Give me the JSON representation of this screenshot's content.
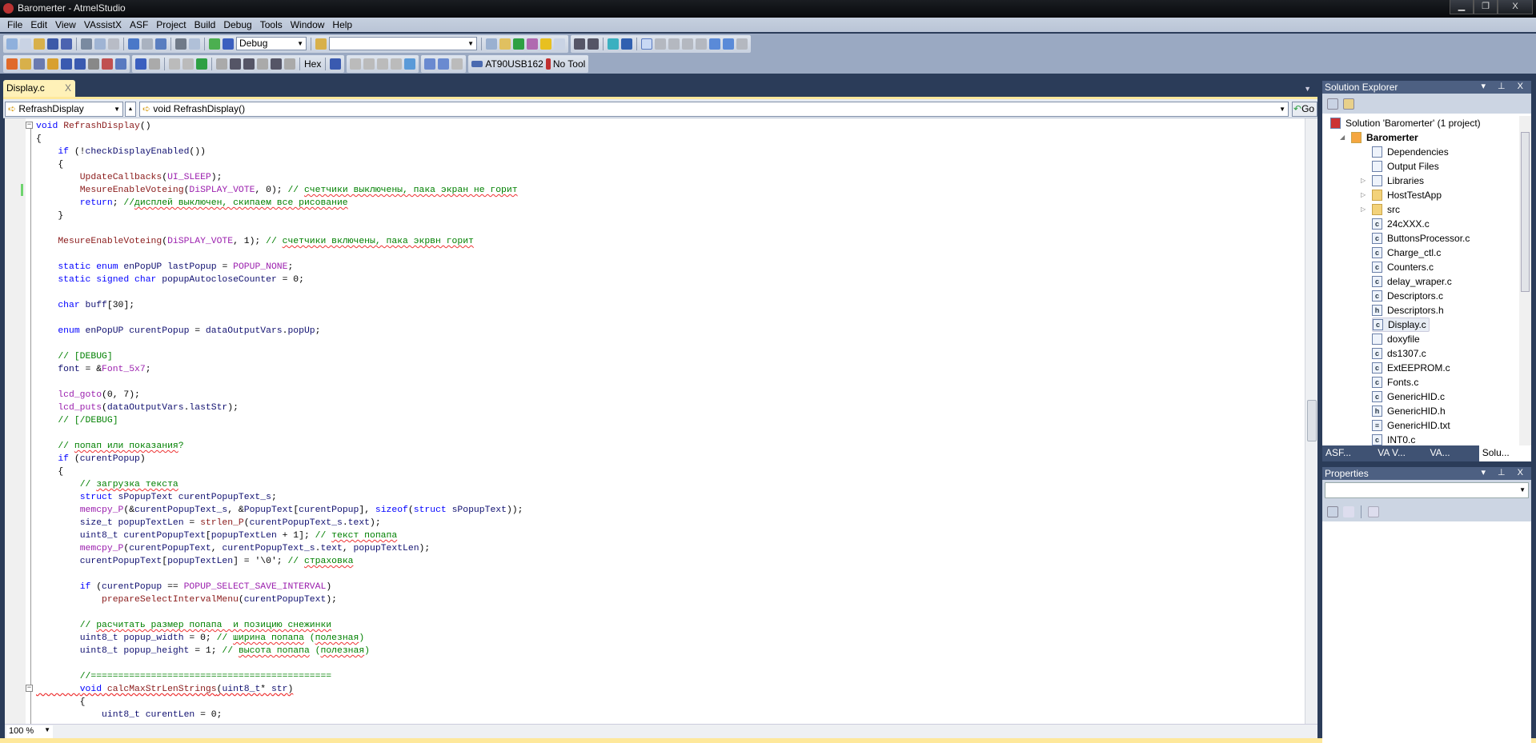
{
  "window": {
    "title": "Baromerter - AtmelStudio",
    "minimize": "▁",
    "restore": "❐",
    "close": "X"
  },
  "menu": [
    "File",
    "Edit",
    "View",
    "VAssistX",
    "ASF",
    "Project",
    "Build",
    "Debug",
    "Tools",
    "Window",
    "Help"
  ],
  "toolbar": {
    "config": "Debug",
    "search_value": "",
    "hex": "Hex",
    "device": "AT90USB162",
    "tool": "No Tool"
  },
  "tabs": [
    {
      "label": "Display.c",
      "close": "X"
    }
  ],
  "nav": {
    "scope": "RefrashDisplay",
    "member": "void RefrashDisplay()",
    "go": "Go"
  },
  "status": {
    "zoom": "100 %"
  },
  "code": [
    [
      [
        "k",
        "void"
      ],
      [
        "t",
        " "
      ],
      [
        "f",
        "RefrashDisplay"
      ],
      [
        "t",
        "()"
      ]
    ],
    [
      [
        "t",
        "{"
      ]
    ],
    [
      [
        "t",
        "    "
      ],
      [
        "k",
        "if"
      ],
      [
        "t",
        " (!"
      ],
      [
        "v",
        "checkDisplayEnabled"
      ],
      [
        "t",
        "())"
      ]
    ],
    [
      [
        "t",
        "    {"
      ]
    ],
    [
      [
        "t",
        "        "
      ],
      [
        "f",
        "UpdateCallbacks"
      ],
      [
        "t",
        "("
      ],
      [
        "m",
        "UI_SLEEP"
      ],
      [
        "t",
        ");"
      ]
    ],
    [
      [
        "t",
        "        "
      ],
      [
        "f",
        "MesureEnableVoteing"
      ],
      [
        "t",
        "("
      ],
      [
        "m",
        "DiSPLAY_VOTE"
      ],
      [
        "t",
        ", 0); "
      ],
      [
        "c",
        "// "
      ],
      [
        "s",
        "счетчики выключены, пака экран не горит"
      ]
    ],
    [
      [
        "t",
        "        "
      ],
      [
        "k",
        "return"
      ],
      [
        "t",
        "; "
      ],
      [
        "c",
        "//"
      ],
      [
        "s",
        "дисплей выключен, скипаем все рисование"
      ]
    ],
    [
      [
        "t",
        "    }"
      ]
    ],
    [],
    [
      [
        "t",
        "    "
      ],
      [
        "f",
        "MesureEnableVoteing"
      ],
      [
        "t",
        "("
      ],
      [
        "m",
        "DiSPLAY_VOTE"
      ],
      [
        "t",
        ", 1); "
      ],
      [
        "c",
        "// "
      ],
      [
        "s",
        "счетчики включены, пака экрвн горит"
      ]
    ],
    [],
    [
      [
        "t",
        "    "
      ],
      [
        "k",
        "static enum"
      ],
      [
        "t",
        " "
      ],
      [
        "v",
        "enPopUP lastPopup"
      ],
      [
        "t",
        " = "
      ],
      [
        "m",
        "POPUP_NONE"
      ],
      [
        "t",
        ";"
      ]
    ],
    [
      [
        "t",
        "    "
      ],
      [
        "k",
        "static signed char"
      ],
      [
        "t",
        " "
      ],
      [
        "v",
        "popupAutocloseCounter"
      ],
      [
        "t",
        " = 0;"
      ]
    ],
    [],
    [
      [
        "t",
        "    "
      ],
      [
        "k",
        "char"
      ],
      [
        "t",
        " "
      ],
      [
        "v",
        "buff"
      ],
      [
        "t",
        "[30];"
      ]
    ],
    [],
    [
      [
        "t",
        "    "
      ],
      [
        "k",
        "enum"
      ],
      [
        "t",
        " "
      ],
      [
        "v",
        "enPopUP curentPopup"
      ],
      [
        "t",
        " = "
      ],
      [
        "v",
        "dataOutputVars"
      ],
      [
        "t",
        "."
      ],
      [
        "v",
        "popUp"
      ],
      [
        "t",
        ";"
      ]
    ],
    [],
    [
      [
        "t",
        "    "
      ],
      [
        "c",
        "// [DEBUG]"
      ]
    ],
    [
      [
        "t",
        "    "
      ],
      [
        "v",
        "font"
      ],
      [
        "t",
        " = &"
      ],
      [
        "m",
        "Font_5x7"
      ],
      [
        "t",
        ";"
      ]
    ],
    [],
    [
      [
        "t",
        "    "
      ],
      [
        "m",
        "lcd_goto"
      ],
      [
        "t",
        "(0, 7);"
      ]
    ],
    [
      [
        "t",
        "    "
      ],
      [
        "m",
        "lcd_puts"
      ],
      [
        "t",
        "("
      ],
      [
        "v",
        "dataOutputVars"
      ],
      [
        "t",
        "."
      ],
      [
        "v",
        "lastStr"
      ],
      [
        "t",
        ");"
      ]
    ],
    [
      [
        "t",
        "    "
      ],
      [
        "c",
        "// [/DEBUG]"
      ]
    ],
    [],
    [
      [
        "t",
        "    "
      ],
      [
        "c",
        "// "
      ],
      [
        "s",
        "попап или показания"
      ],
      [
        "c",
        "?"
      ]
    ],
    [
      [
        "t",
        "    "
      ],
      [
        "k",
        "if"
      ],
      [
        "t",
        " ("
      ],
      [
        "v",
        "curentPopup"
      ],
      [
        "t",
        ")"
      ]
    ],
    [
      [
        "t",
        "    {"
      ]
    ],
    [
      [
        "t",
        "        "
      ],
      [
        "c",
        "// "
      ],
      [
        "s",
        "загрузка текста"
      ]
    ],
    [
      [
        "t",
        "        "
      ],
      [
        "k",
        "struct"
      ],
      [
        "t",
        " "
      ],
      [
        "v",
        "sPopupText curentPopupText_s"
      ],
      [
        "t",
        ";"
      ]
    ],
    [
      [
        "t",
        "        "
      ],
      [
        "m",
        "memcpy_P"
      ],
      [
        "t",
        "(&"
      ],
      [
        "v",
        "curentPopupText_s"
      ],
      [
        "t",
        ", &"
      ],
      [
        "v",
        "PopupText"
      ],
      [
        "t",
        "["
      ],
      [
        "v",
        "curentPopup"
      ],
      [
        "t",
        "], "
      ],
      [
        "k",
        "sizeof"
      ],
      [
        "t",
        "("
      ],
      [
        "k",
        "struct"
      ],
      [
        "t",
        " "
      ],
      [
        "v",
        "sPopupText"
      ],
      [
        "t",
        "));"
      ]
    ],
    [
      [
        "t",
        "        "
      ],
      [
        "v",
        "size_t popupTextLen"
      ],
      [
        "t",
        " = "
      ],
      [
        "f",
        "strlen_P"
      ],
      [
        "t",
        "("
      ],
      [
        "v",
        "curentPopupText_s"
      ],
      [
        "t",
        "."
      ],
      [
        "v",
        "text"
      ],
      [
        "t",
        ");"
      ]
    ],
    [
      [
        "t",
        "        "
      ],
      [
        "v",
        "uint8_t curentPopupText"
      ],
      [
        "t",
        "["
      ],
      [
        "v",
        "popupTextLen"
      ],
      [
        "t",
        " + 1]; "
      ],
      [
        "c",
        "// "
      ],
      [
        "s",
        "текст попапа"
      ]
    ],
    [
      [
        "t",
        "        "
      ],
      [
        "m",
        "memcpy_P"
      ],
      [
        "t",
        "("
      ],
      [
        "v",
        "curentPopupText"
      ],
      [
        "t",
        ", "
      ],
      [
        "v",
        "curentPopupText_s"
      ],
      [
        "t",
        "."
      ],
      [
        "v",
        "text"
      ],
      [
        "t",
        ", "
      ],
      [
        "v",
        "popupTextLen"
      ],
      [
        "t",
        ");"
      ]
    ],
    [
      [
        "t",
        "        "
      ],
      [
        "v",
        "curentPopupText"
      ],
      [
        "t",
        "["
      ],
      [
        "v",
        "popupTextLen"
      ],
      [
        "t",
        "] = '\\0'; "
      ],
      [
        "c",
        "// "
      ],
      [
        "s",
        "страховка"
      ]
    ],
    [],
    [
      [
        "t",
        "        "
      ],
      [
        "k",
        "if"
      ],
      [
        "t",
        " ("
      ],
      [
        "v",
        "curentPopup"
      ],
      [
        "t",
        " == "
      ],
      [
        "m",
        "POPUP_SELECT_SAVE_INTERVAL"
      ],
      [
        "t",
        ")"
      ]
    ],
    [
      [
        "t",
        "            "
      ],
      [
        "f",
        "prepareSelectIntervalMenu"
      ],
      [
        "t",
        "("
      ],
      [
        "v",
        "curentPopupText"
      ],
      [
        "t",
        ");"
      ]
    ],
    [],
    [
      [
        "t",
        "        "
      ],
      [
        "c",
        "// "
      ],
      [
        "s",
        "расчитать размер попапа  и позицию снежинки"
      ]
    ],
    [
      [
        "t",
        "        "
      ],
      [
        "v",
        "uint8_t popup_width"
      ],
      [
        "t",
        " = 0; "
      ],
      [
        "c",
        "// "
      ],
      [
        "s",
        "ширина попапа"
      ],
      [
        "c",
        " ("
      ],
      [
        "s",
        "полезная"
      ],
      [
        "c",
        ")"
      ]
    ],
    [
      [
        "t",
        "        "
      ],
      [
        "v",
        "uint8_t popup_height"
      ],
      [
        "t",
        " = 1; "
      ],
      [
        "c",
        "// "
      ],
      [
        "s",
        "высота попапа"
      ],
      [
        "c",
        " ("
      ],
      [
        "s",
        "полезная"
      ],
      [
        "c",
        ")"
      ]
    ],
    [],
    [
      [
        "t",
        "        "
      ],
      [
        "c",
        "//============================================"
      ]
    ],
    [
      [
        "t",
        "        "
      ],
      [
        "k",
        "void"
      ],
      [
        "t",
        " "
      ],
      [
        "f",
        "calcMaxStrLenStrings"
      ],
      [
        "t",
        "("
      ],
      [
        "v",
        "uint8_t"
      ],
      [
        "t",
        "* "
      ],
      [
        "v",
        "str"
      ],
      [
        "t",
        ")"
      ]
    ],
    [
      [
        "t",
        "        {"
      ]
    ],
    [
      [
        "t",
        "            "
      ],
      [
        "v",
        "uint8_t curentLen"
      ],
      [
        "t",
        " = 0;"
      ]
    ]
  ],
  "solution_explorer": {
    "title": "Solution Explorer",
    "controls": "▾ ⊥ X",
    "tree": [
      {
        "label": "Solution 'Baromerter' (1 project)",
        "icon": "sln",
        "level": 0
      },
      {
        "label": "Baromerter",
        "icon": "proj",
        "level": 1,
        "bold": true,
        "expander": "◢"
      },
      {
        "label": "Dependencies",
        "icon": "ref",
        "level": 2
      },
      {
        "label": "Output Files",
        "icon": "ref",
        "level": 2
      },
      {
        "label": "Libraries",
        "icon": "lib",
        "level": 2,
        "expander": "▷"
      },
      {
        "label": "HostTestApp",
        "icon": "folder",
        "level": 2,
        "expander": "▷"
      },
      {
        "label": "src",
        "icon": "folder",
        "level": 2,
        "expander": "▷"
      },
      {
        "label": "24cXXX.c",
        "icon": "c",
        "level": 2
      },
      {
        "label": "ButtonsProcessor.c",
        "icon": "c",
        "level": 2
      },
      {
        "label": "Charge_ctl.c",
        "icon": "c",
        "level": 2
      },
      {
        "label": "Counters.c",
        "icon": "c",
        "level": 2
      },
      {
        "label": "delay_wraper.c",
        "icon": "c",
        "level": 2
      },
      {
        "label": "Descriptors.c",
        "icon": "c",
        "level": 2
      },
      {
        "label": "Descriptors.h",
        "icon": "h",
        "level": 2
      },
      {
        "label": "Display.c",
        "icon": "c",
        "level": 2,
        "selected": true
      },
      {
        "label": "doxyfile",
        "icon": "file",
        "level": 2
      },
      {
        "label": "ds1307.c",
        "icon": "c",
        "level": 2
      },
      {
        "label": "ExtEEPROM.c",
        "icon": "c",
        "level": 2
      },
      {
        "label": "Fonts.c",
        "icon": "c",
        "level": 2
      },
      {
        "label": "GenericHID.c",
        "icon": "c",
        "level": 2
      },
      {
        "label": "GenericHID.h",
        "icon": "h",
        "level": 2
      },
      {
        "label": "GenericHID.txt",
        "icon": "txt",
        "level": 2
      },
      {
        "label": "INT0.c",
        "icon": "c",
        "level": 2
      }
    ],
    "tabs": [
      "ASF...",
      "VA V...",
      "VA...",
      "Solu..."
    ]
  },
  "properties": {
    "title": "Properties",
    "controls": "▾ ⊥ X"
  },
  "colors": {
    "accent": "#fee89b",
    "panel_header": "#4d6082",
    "background": "#2b3c59"
  }
}
